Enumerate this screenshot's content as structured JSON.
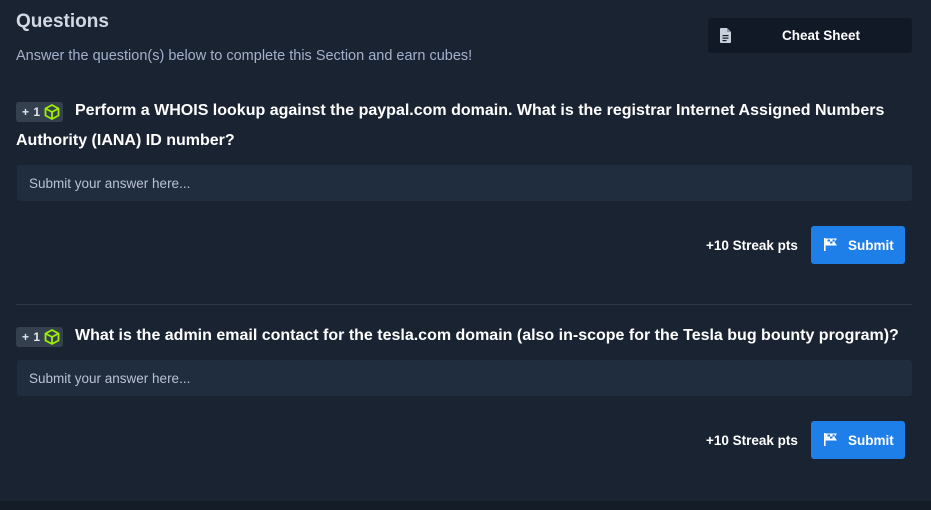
{
  "header": {
    "title": "Questions",
    "subtitle": "Answer the question(s) below to complete this Section and earn cubes!",
    "cheat_sheet_label": "Cheat Sheet",
    "cheat_sheet_icon": "document-icon"
  },
  "questions": [
    {
      "badge": "+ 1",
      "badge_icon": "cube-icon",
      "text": "Perform a WHOIS lookup against the paypal.com domain. What is the registrar Internet Assigned Numbers Authority (IANA) ID number?",
      "placeholder": "Submit your answer here...",
      "streak": "+10 Streak pts",
      "submit_label": "Submit",
      "submit_icon": "flag-icon"
    },
    {
      "badge": "+ 1",
      "badge_icon": "cube-icon",
      "text": "What is the admin email contact for the tesla.com domain (also in-scope for the Tesla bug bounty program)?",
      "placeholder": "Submit your answer here...",
      "streak": "+10 Streak pts",
      "submit_label": "Submit",
      "submit_icon": "flag-icon"
    }
  ],
  "colors": {
    "background": "#1a2332",
    "input_bg": "#202d3f",
    "submit_bg": "#1f7fe8",
    "cube_green": "#9fef00",
    "badge_bg": "#35404f"
  }
}
